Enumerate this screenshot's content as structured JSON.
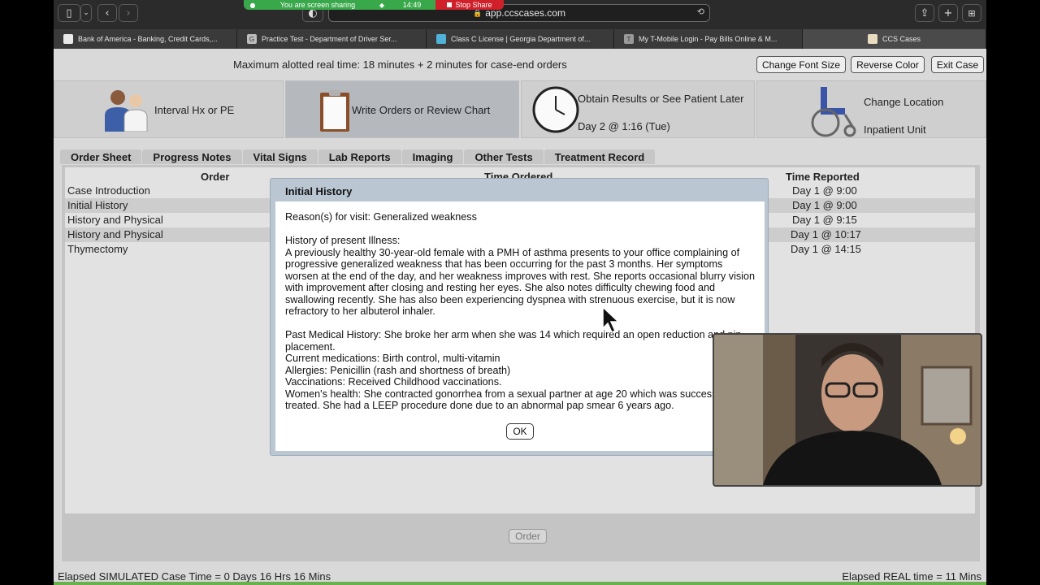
{
  "browser": {
    "address": "app.ccscases.com",
    "share_banner": {
      "message": "You are screen sharing",
      "time": "14:49",
      "stop_label": "Stop Share"
    },
    "tabs": [
      {
        "label": "Bank of America - Banking, Credit Cards,...",
        "fav": "",
        "color": "#e9e9e9"
      },
      {
        "label": "Practice Test - Department of Driver Ser...",
        "fav": "G",
        "color": "#bdbdbd"
      },
      {
        "label": "Class C License | Georgia Department of...",
        "fav": "",
        "color": "#4fb3d9"
      },
      {
        "label": "My T-Mobile Login - Pay Bills Online & M...",
        "fav": "T",
        "color": "#9a9a9a"
      },
      {
        "label": "CCS Cases",
        "fav": "",
        "color": "#e8dcc0"
      }
    ]
  },
  "header": {
    "max_time": "Maximum alotted real time: 18 minutes + 2 minutes for case-end orders",
    "buttons": {
      "font": "Change Font Size",
      "color": "Reverse Color",
      "exit": "Exit Case"
    }
  },
  "nav": {
    "interval": "Interval Hx or PE",
    "orders": "Write Orders or Review Chart",
    "results": "Obtain Results or See Patient Later",
    "day": "Day 2 @ 1:16 (Tue)",
    "location": "Change Location",
    "unit": "Inpatient Unit"
  },
  "chart_tabs": [
    "Order Sheet",
    "Progress Notes",
    "Vital Signs",
    "Lab Reports",
    "Imaging",
    "Other Tests",
    "Treatment Record"
  ],
  "table": {
    "headers": {
      "order": "Order",
      "ordered": "Time Ordered",
      "reported": "Time Reported"
    },
    "rows": [
      {
        "order": "Case Introduction",
        "reported": "Day 1 @ 9:00"
      },
      {
        "order": "Initial History",
        "reported": "Day 1 @ 9:00"
      },
      {
        "order": "History and Physical",
        "reported": "Day 1 @ 9:15"
      },
      {
        "order": "History and Physical",
        "reported": "Day 1 @ 10:17"
      },
      {
        "order": "Thymectomy",
        "reported": "Day 1 @ 14:15"
      }
    ],
    "order_button": "Order"
  },
  "footer": {
    "sim": "Elapsed SIMULATED Case Time = 0 Days 16 Hrs 16 Mins",
    "real": "Elapsed REAL time = 11 Mins"
  },
  "modal": {
    "title": "Initial History",
    "reason": "Reason(s) for visit: Generalized weakness",
    "hpi_heading": "History of present Illness:",
    "hpi": "A previously healthy 30-year-old female with a PMH of asthma presents to your office complaining of progressive generalized weakness that has been occurring for the past 3 months. Her symptoms worsen at the end of the day, and her weakness improves with rest. She reports occasional blurry vision with improvement after closing and resting her eyes. She also notes difficulty chewing food and swallowing recently. She has also been experiencing dyspnea with strenuous exercise, but it is now refractory to her albuterol inhaler.",
    "pmh": "Past Medical History: She broke her arm when she was 14 which required an open reduction and pin placement.",
    "meds": "Current medications: Birth control, multi-vitamin",
    "allergies": "Allergies: Penicillin (rash and shortness of breath)",
    "vacc": "Vaccinations: Received Childhood vaccinations.",
    "womens": "Women's health: She contracted gonorrhea from a sexual partner at age 20 which was successfully treated. She had a LEEP procedure done due to an abnormal pap smear 6 years ago.",
    "ok": "OK"
  }
}
